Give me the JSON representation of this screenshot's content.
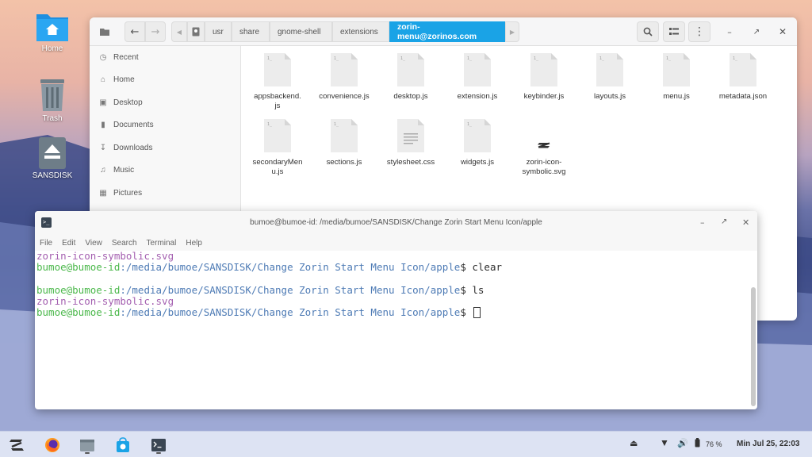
{
  "desktop": {
    "icons": [
      {
        "label": "Home"
      },
      {
        "label": "Trash"
      },
      {
        "label": "SANSDISK"
      }
    ]
  },
  "file_manager": {
    "breadcrumbs": [
      "usr",
      "share",
      "gnome-shell",
      "extensions",
      "zorin-menu@zorinos.com"
    ],
    "sidebar": [
      "Recent",
      "Home",
      "Desktop",
      "Documents",
      "Downloads",
      "Music",
      "Pictures"
    ],
    "files": [
      {
        "name": "appsbackend.\njs",
        "type": "js"
      },
      {
        "name": "convenience.js",
        "type": "js"
      },
      {
        "name": "desktop.js",
        "type": "js"
      },
      {
        "name": "extension.js",
        "type": "js"
      },
      {
        "name": "keybinder.js",
        "type": "js"
      },
      {
        "name": "layouts.js",
        "type": "js"
      },
      {
        "name": "menu.js",
        "type": "js"
      },
      {
        "name": "metadata.json",
        "type": "json"
      },
      {
        "name": "secondaryMen\nu.js",
        "type": "js"
      },
      {
        "name": "sections.js",
        "type": "js"
      },
      {
        "name": "stylesheet.css",
        "type": "css"
      },
      {
        "name": "widgets.js",
        "type": "js"
      },
      {
        "name": "zorin-icon-\nsymbolic.svg",
        "type": "svg"
      }
    ]
  },
  "terminal": {
    "title": "bumoe@bumoe-id: /media/bumoe/SANSDISK/Change Zorin Start Menu Icon/apple",
    "menu": [
      "File",
      "Edit",
      "View",
      "Search",
      "Terminal",
      "Help"
    ],
    "lines": {
      "l1": "zorin-icon-symbolic.svg",
      "l2_user": "bumoe@bumoe-id",
      "l2_path": ":/media/bumoe/SANSDISK/Change Zorin Start Menu Icon/apple",
      "l2_cmd": "$ clear",
      "l3_user": "bumoe@bumoe-id",
      "l3_path": ":/media/bumoe/SANSDISK/Change Zorin Start Menu Icon/apple",
      "l3_cmd": "$ ls",
      "l4": "zorin-icon-symbolic.svg",
      "l5_user": "bumoe@bumoe-id",
      "l5_path": ":/media/bumoe/SANSDISK/Change Zorin Start Menu Icon/apple",
      "l5_cmd": "$ "
    }
  },
  "taskbar": {
    "battery": "76 %",
    "clock": "Min Jul 25, 22:03"
  },
  "colors": {
    "accent": "#1aa3e6",
    "term_user": "#4bb84b",
    "term_path": "#4e7bb5",
    "term_file": "#a45fb0"
  }
}
